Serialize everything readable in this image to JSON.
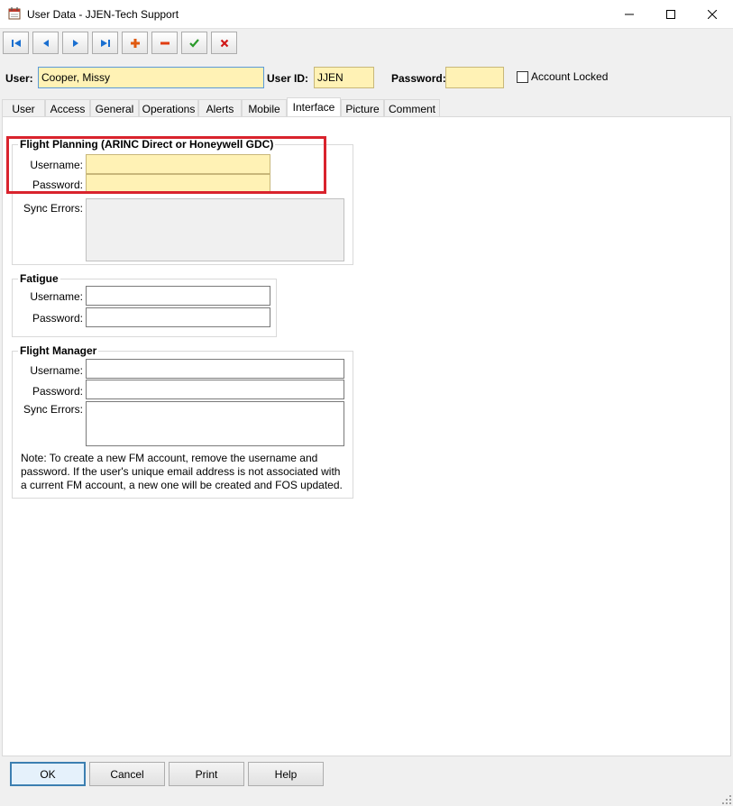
{
  "window": {
    "title": "User Data - JJEN-Tech Support",
    "minimize_icon": "minimize-icon",
    "maximize_icon": "maximize-icon",
    "close_icon": "close-icon"
  },
  "toolbar": {
    "buttons": [
      "first-record-icon",
      "previous-record-icon",
      "next-record-icon",
      "last-record-icon",
      "add-icon",
      "delete-icon",
      "save-check-icon",
      "cancel-x-icon"
    ],
    "colors": {
      "nav": "#1a6fd0",
      "add": "#e05a10",
      "delete": "#e03c10",
      "save": "#2a9a2a",
      "cancel": "#d01818"
    }
  },
  "header": {
    "user_label": "User:",
    "user_value": "Cooper, Missy",
    "userid_label": "User ID:",
    "userid_value": "JJEN",
    "password_label": "Password:",
    "password_value": "",
    "account_locked_label": "Account Locked",
    "account_locked_checked": false
  },
  "tabs": [
    "User",
    "Access",
    "General",
    "Operations",
    "Alerts",
    "Mobile",
    "Interface",
    "Picture",
    "Comment"
  ],
  "active_tab": "Interface",
  "flight_planning": {
    "title": "Flight Planning (ARINC Direct or Honeywell GDC)",
    "username_label": "Username:",
    "username_value": "",
    "password_label": "Password:",
    "password_value": "",
    "sync_errors_label": "Sync Errors:",
    "sync_errors_value": ""
  },
  "fatigue": {
    "title": "Fatigue",
    "username_label": "Username:",
    "username_value": "",
    "password_label": "Password:",
    "password_value": ""
  },
  "flight_manager": {
    "title": "Flight Manager",
    "username_label": "Username:",
    "username_value": "",
    "password_label": "Password:",
    "password_value": "",
    "sync_errors_label": "Sync Errors:",
    "sync_errors_value": "",
    "note_lines": [
      "Note: To create a new FM account, remove the username and",
      "password. If the user's unique email address is not associated with",
      "a current FM account, a new one will be created and FOS updated."
    ]
  },
  "buttons": {
    "ok": "OK",
    "cancel": "Cancel",
    "print": "Print",
    "help": "Help"
  },
  "highlight_color": "#d9232d"
}
